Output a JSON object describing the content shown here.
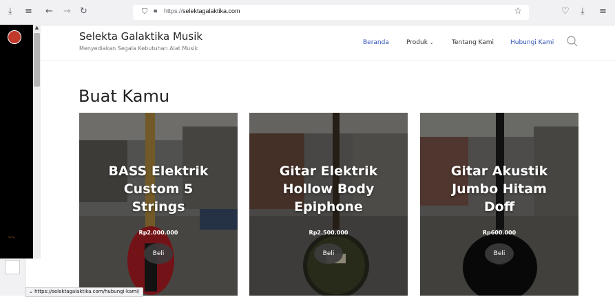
{
  "browser": {
    "url_prefix": "https://",
    "url_domain": "selektagalaktika.com",
    "status_url": "https://selektagalaktika.com/hubungi-kami/"
  },
  "site": {
    "title": "Selekta Galaktika Musik",
    "tagline": "Menyediakan Segala Kebutuhan Alat Musik"
  },
  "nav": {
    "items": [
      {
        "label": "Beranda"
      },
      {
        "label": "Produk"
      },
      {
        "label": "Tentang Kami"
      },
      {
        "label": "Hubungi Kami"
      }
    ]
  },
  "section": {
    "title": "Buat Kamu"
  },
  "products": [
    {
      "name_line1": "BASS Elektrik",
      "name_line2": "Custom 5",
      "name_line3": "Strings",
      "price": "Rp2.000.000",
      "buy_label": "Beli"
    },
    {
      "name_line1": "Gitar Elektrik",
      "name_line2": "Hollow Body",
      "name_line3": "Epiphone",
      "price": "Rp2.500.000",
      "buy_label": "Beli"
    },
    {
      "name_line1": "Gitar Akustik",
      "name_line2": "Jumbo Hitam",
      "name_line3": "Doff",
      "price": "Rp600.000",
      "buy_label": "Beli"
    }
  ],
  "icons": {
    "download": "download-icon",
    "menu": "menu-icon",
    "back": "back-arrow-icon",
    "forward": "forward-arrow-icon",
    "reload": "reload-icon",
    "star": "bookmark-star-icon",
    "search": "search-icon"
  },
  "colors": {
    "nav_active": "#2d4fb6",
    "browser_chrome": "#f1f1f3"
  }
}
